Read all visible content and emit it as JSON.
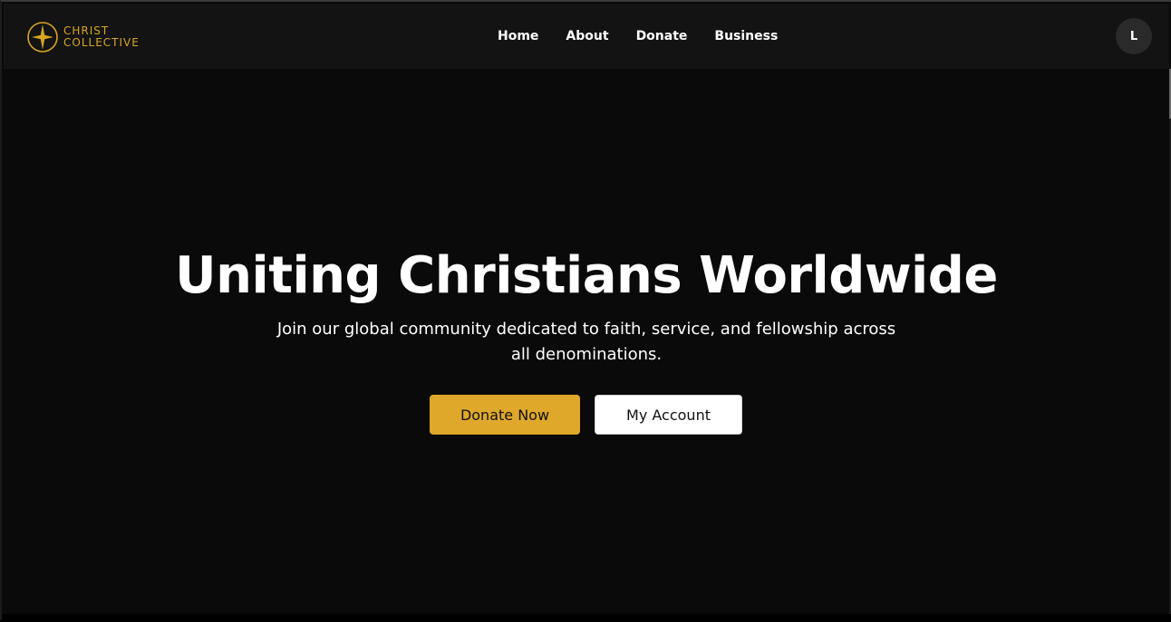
{
  "brand": {
    "line1": "CHRIST",
    "line2": "COLLECTIVE",
    "icon": "star-icon",
    "color": "#d9a520"
  },
  "nav": {
    "items": [
      {
        "label": "Home"
      },
      {
        "label": "About"
      },
      {
        "label": "Donate"
      },
      {
        "label": "Business"
      }
    ]
  },
  "user": {
    "avatar_initial": "L"
  },
  "hero": {
    "title": "Uniting Christians Worldwide",
    "subtitle": "Join our global community dedicated to faith, service, and fellowship across all denominations.",
    "primary_button": "Donate Now",
    "secondary_button": "My Account"
  },
  "colors": {
    "accent": "#e0a82b",
    "background": "#0a0a0a",
    "navbar": "#131313"
  }
}
